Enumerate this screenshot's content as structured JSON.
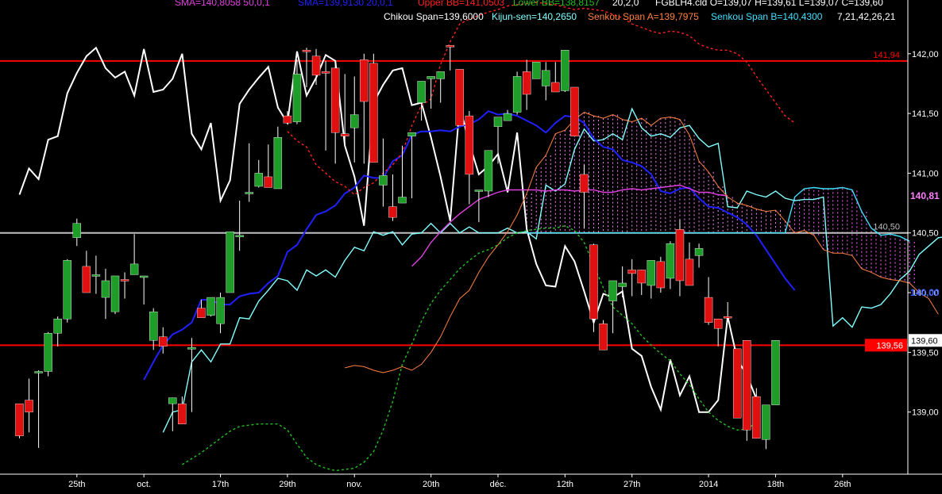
{
  "chart_data": {
    "type": "candlestick",
    "symbol_line": "FGBLH4.cld O=139,07 H=139,61 L=139,07 C=139,60",
    "indicator_labels": [
      {
        "text": "SMA=140,8058  50,0,1",
        "color": "#e040e0"
      },
      {
        "text": "SMA=139,9130  20,0,1",
        "color": "#2020ff"
      },
      {
        "text": "Upper BB=141,0503",
        "color": "#ff2020"
      },
      {
        "text": "Lower BB=138,8157",
        "color": "#20c020"
      },
      {
        "text": "20,2,0",
        "color": "#ffffff"
      },
      {
        "text": "Chikou Span=139,6000",
        "color": "#ffffff"
      },
      {
        "text": "Kijun-sen=140,2650",
        "color": "#80ffff"
      },
      {
        "text": "Senkou Span A=139,7975",
        "color": "#ff8040"
      },
      {
        "text": "Senkou Span B=140,4300",
        "color": "#40e0ff"
      },
      {
        "text": "7,21,42,26,21",
        "color": "#ffffff"
      }
    ],
    "y_axis": {
      "min": 138.48,
      "max": 142.45,
      "ticks": [
        "139,00",
        "139,50",
        "140,00",
        "140,50",
        "141,00",
        "141,50",
        "142,00"
      ],
      "tick_values": [
        139.0,
        139.5,
        140.0,
        140.5,
        141.0,
        141.5,
        142.0
      ]
    },
    "x_axis": {
      "labels": [
        "25th",
        "oct.",
        "17th",
        "29th",
        "nov.",
        "20th",
        "déc.",
        "12th",
        "27th",
        "2014",
        "18th",
        "26th"
      ],
      "label_bars": [
        6,
        13,
        21,
        28,
        35,
        43,
        50,
        57,
        64,
        72,
        79,
        86
      ],
      "total_bars": 94
    },
    "horizontal_lines": [
      {
        "value": 141.94,
        "label": "141,94",
        "color": "#ff0000"
      },
      {
        "value": 140.5,
        "label": "140,50",
        "color": "#c0c0c0"
      },
      {
        "value": 139.56,
        "label": "139,56",
        "color": "#ff0000"
      }
    ],
    "price_badges": [
      {
        "value": 140.81,
        "label": "140,81",
        "color": "#ff80ff"
      },
      {
        "value": 140.0,
        "label": "140,00",
        "color": "#4060ff"
      },
      {
        "value": 139.6,
        "label": "139,60",
        "color": "#ffffff"
      }
    ],
    "candles": [
      [
        139.07,
        139.07,
        138.78,
        138.8
      ],
      [
        139.1,
        139.28,
        138.83,
        139.0
      ],
      [
        139.34,
        139.35,
        138.7,
        139.34
      ],
      [
        139.34,
        139.67,
        139.3,
        139.66
      ],
      [
        139.66,
        139.8,
        139.55,
        139.78
      ],
      [
        139.78,
        140.28,
        139.75,
        140.27
      ],
      [
        140.46,
        140.62,
        140.39,
        140.58
      ],
      [
        140.22,
        140.35,
        140.0,
        140.0
      ],
      [
        140.14,
        140.31,
        139.99,
        140.15
      ],
      [
        139.96,
        140.2,
        139.78,
        140.1
      ],
      [
        139.84,
        140.05,
        139.82,
        140.14
      ],
      [
        140.11,
        140.17,
        139.95,
        140.1
      ],
      [
        140.15,
        140.49,
        140.15,
        140.24
      ],
      [
        140.14,
        140.1,
        139.9,
        140.14
      ],
      [
        139.6,
        139.87,
        139.52,
        139.84
      ],
      [
        139.63,
        139.71,
        139.49,
        139.55
      ],
      [
        139.07,
        139.05,
        138.84,
        139.12
      ],
      [
        139.07,
        139.13,
        138.91,
        138.9
      ],
      [
        139.53,
        139.62,
        139.0,
        139.54
      ],
      [
        139.87,
        139.94,
        139.8,
        139.79
      ],
      [
        139.81,
        139.95,
        139.8,
        139.96
      ],
      [
        139.74,
        140.0,
        139.66,
        139.96
      ],
      [
        140.0,
        140.48,
        140.0,
        140.51
      ],
      [
        140.47,
        140.77,
        140.35,
        140.48
      ],
      [
        140.83,
        141.25,
        140.76,
        140.84
      ],
      [
        140.89,
        141.11,
        140.88,
        141.0
      ],
      [
        140.97,
        141.24,
        140.96,
        140.88
      ],
      [
        140.87,
        141.39,
        141.0,
        141.3
      ],
      [
        141.48,
        141.45,
        141.52,
        141.42
      ],
      [
        141.43,
        141.95,
        141.41,
        141.83
      ],
      [
        142.03,
        142.05,
        141.72,
        142.02
      ],
      [
        141.98,
        142.04,
        141.74,
        141.82
      ],
      [
        141.85,
        141.94,
        141.19,
        141.84
      ],
      [
        141.88,
        141.93,
        141.08,
        141.34
      ],
      [
        141.33,
        141.83,
        141.23,
        141.31
      ],
      [
        141.38,
        141.81,
        141.09,
        141.49
      ],
      [
        141.95,
        142.0,
        141.08,
        141.6
      ],
      [
        141.92,
        142.0,
        141.73,
        141.09
      ],
      [
        140.9,
        141.29,
        140.72,
        140.98
      ],
      [
        140.72,
        140.99,
        140.6,
        140.63
      ],
      [
        140.75,
        141.23,
        140.75,
        140.8
      ],
      [
        141.31,
        141.31,
        140.79,
        141.34
      ],
      [
        141.59,
        141.54,
        141.44,
        141.77
      ],
      [
        141.79,
        141.78,
        141.54,
        141.81
      ],
      [
        141.79,
        141.59,
        141.7,
        141.85
      ],
      [
        142.07,
        142.05,
        141.86,
        142.06
      ],
      [
        141.87,
        141.86,
        141.82,
        141.4
      ],
      [
        141.48,
        141.52,
        140.74,
        140.99
      ],
      [
        140.85,
        140.79,
        140.59,
        140.86
      ],
      [
        140.85,
        140.96,
        140.8,
        141.19
      ],
      [
        141.39,
        141.35,
        141.08,
        141.47
      ],
      [
        141.44,
        141.53,
        141.46,
        141.5
      ],
      [
        141.51,
        141.85,
        141.49,
        141.81
      ],
      [
        141.85,
        141.95,
        141.53,
        141.66
      ],
      [
        141.79,
        141.84,
        141.84,
        141.93
      ],
      [
        141.73,
        141.93,
        141.61,
        141.86
      ],
      [
        141.76,
        141.93,
        141.8,
        141.68
      ],
      [
        141.69,
        142.0,
        141.68,
        142.03
      ],
      [
        141.72,
        141.63,
        141.36,
        141.31
      ],
      [
        140.99,
        141.07,
        140.54,
        140.84
      ],
      [
        140.4,
        140.41,
        139.67,
        139.78
      ],
      [
        139.74,
        139.76,
        139.77,
        139.52
      ],
      [
        139.93,
        139.93,
        139.66,
        140.1
      ],
      [
        140.05,
        140.22,
        139.96,
        140.08
      ],
      [
        140.19,
        140.28,
        139.97,
        140.16
      ],
      [
        140.19,
        140.15,
        139.98,
        140.08
      ],
      [
        140.06,
        140.1,
        139.95,
        140.27
      ],
      [
        140.26,
        140.3,
        140.0,
        140.04
      ],
      [
        140.12,
        140.43,
        140.03,
        140.41
      ],
      [
        140.53,
        140.61,
        139.97,
        140.1
      ],
      [
        140.28,
        140.42,
        140.35,
        140.06
      ],
      [
        140.31,
        140.41,
        140.21,
        140.37
      ],
      [
        139.96,
        140.13,
        139.73,
        139.75
      ],
      [
        139.78,
        139.78,
        139.55,
        139.7
      ],
      [
        139.8,
        139.92,
        139.79,
        139.79
      ],
      [
        139.53,
        139.5,
        139.0,
        138.95
      ],
      [
        139.6,
        139.58,
        138.76,
        138.85
      ],
      [
        139.13,
        139.2,
        138.8,
        138.78
      ],
      [
        138.77,
        139.0,
        138.69,
        139.06
      ],
      [
        139.06,
        139.07,
        139.07,
        139.6
      ]
    ],
    "series": [
      {
        "name": "Chikou Span",
        "color": "#ffffff",
        "values": [
          140.82,
          141.04,
          140.95,
          141.28,
          141.31,
          141.67,
          141.84,
          141.98,
          142.05,
          141.88,
          141.8,
          141.85,
          141.65,
          142.04,
          141.68,
          141.7,
          141.79,
          142.0,
          141.33,
          141.2,
          141.42,
          140.77,
          140.94,
          141.58,
          141.7,
          141.8,
          141.89,
          141.55,
          141.42,
          142.02,
          141.65,
          141.8,
          141.99,
          141.94,
          141.23,
          140.97,
          140.56,
          141.59,
          141.74,
          141.86,
          141.88,
          141.57,
          141.59,
          141.3,
          140.97,
          140.6,
          141.56,
          141.25,
          140.99,
          141.06,
          141.16,
          140.84,
          141.34,
          140.53,
          140.24,
          140.06,
          140.05,
          140.39,
          140.26,
          140.01,
          139.75,
          139.99,
          139.96,
          140.01,
          139.53,
          139.47,
          139.21,
          139.02,
          139.44,
          139.14,
          139.3,
          139.0,
          139.0,
          139.1,
          139.8,
          139.44,
          139.31,
          139.11
        ]
      },
      {
        "name": "Kijun-sen",
        "color": "#80ffff",
        "values": [
          138.83,
          139.0,
          139.02,
          139.42,
          139.52,
          139.42,
          139.57,
          139.57,
          139.79,
          139.78,
          139.93,
          140.02,
          140.12,
          140.1,
          140.02,
          140.19,
          140.14,
          140.19,
          140.13,
          140.27,
          140.38,
          140.35,
          140.51,
          140.48,
          140.51,
          140.4,
          140.49,
          140.5,
          140.58,
          140.5,
          140.58,
          140.5,
          140.55,
          140.5,
          140.5,
          140.5,
          140.54,
          140.5,
          140.51,
          140.45,
          140.9,
          140.85,
          140.91,
          141.2,
          141.37,
          141.27,
          141.28,
          141.33,
          141.28,
          141.54,
          141.38,
          141.31,
          141.33,
          141.3,
          141.38,
          141.4,
          141.29,
          141.22,
          141.25,
          140.72,
          140.71,
          140.85,
          140.82,
          140.8,
          140.85,
          140.79,
          140.77,
          140.78,
          140.78,
          140.8,
          139.72,
          139.79,
          139.71,
          139.88,
          139.87,
          139.9,
          139.99,
          140.11,
          140.18,
          140.32,
          140.39,
          140.46,
          140.47,
          140.5
        ]
      },
      {
        "name": "SMA 20",
        "color": "#2020ff",
        "values": [
          139.27,
          139.42,
          139.56,
          139.65,
          139.69,
          139.75,
          139.94,
          139.94,
          139.9,
          139.9,
          139.97,
          139.99,
          140.0,
          140.08,
          140.14,
          140.34,
          140.4,
          140.53,
          140.65,
          140.68,
          140.73,
          140.83,
          140.88,
          140.98,
          140.96,
          140.96,
          141.1,
          141.15,
          141.32,
          141.35,
          141.35,
          141.36,
          141.35,
          141.39,
          141.41,
          141.45,
          141.52,
          141.49,
          141.5,
          141.48,
          141.44,
          141.4,
          141.34,
          141.42,
          141.48,
          141.47,
          141.42,
          141.29,
          141.22,
          141.2,
          141.11,
          141.09,
          141.06,
          140.99,
          140.85,
          140.83,
          140.87,
          140.88,
          140.79,
          140.72,
          140.71,
          140.67,
          140.63,
          140.57,
          140.48,
          140.36,
          140.24,
          140.12,
          140.02
        ]
      },
      {
        "name": "SMA 50",
        "color": "#e040e0",
        "values": [
          140.22,
          140.3,
          140.42,
          140.51,
          140.59,
          140.66,
          140.72,
          140.78,
          140.81,
          140.84,
          140.86,
          140.86,
          140.86,
          140.86,
          140.85,
          140.86,
          140.86,
          140.85,
          140.86,
          140.86,
          140.84,
          140.84,
          140.86,
          140.87,
          140.86,
          140.87,
          140.88,
          140.89,
          140.9,
          140.87,
          140.84,
          140.84,
          140.82,
          140.81
        ]
      },
      {
        "name": "Senkou Span A",
        "color": "#ff8040",
        "values": [
          139.37,
          139.39,
          139.38,
          139.35,
          139.33,
          139.35,
          139.38,
          139.35,
          139.4,
          139.5,
          139.63,
          139.8,
          139.95,
          140.02,
          140.17,
          140.3,
          140.4,
          140.51,
          140.65,
          140.83,
          141.05,
          141.15,
          141.33,
          141.36,
          141.45,
          141.51,
          141.48,
          141.46,
          141.49,
          141.45,
          141.43,
          141.46,
          141.4,
          141.46,
          141.47,
          141.45,
          141.32,
          141.1,
          141.01,
          140.89,
          140.8,
          140.75,
          140.73,
          140.7,
          140.68,
          140.69,
          140.6,
          140.5,
          140.52,
          140.48,
          140.36,
          140.33,
          140.33,
          140.31,
          140.2,
          140.17,
          140.13,
          140.11,
          140.1,
          140.08,
          140.0,
          139.95,
          139.82
        ]
      },
      {
        "name": "Senkou Span B",
        "color": "#40e0ff",
        "values": [
          140.5,
          140.5,
          140.5,
          140.5,
          140.5,
          140.5,
          140.5,
          140.5,
          140.5,
          140.5,
          140.5,
          140.5,
          140.5,
          140.5,
          140.5,
          140.5,
          140.5,
          140.5,
          140.5,
          140.5,
          140.5,
          140.5,
          140.5,
          140.5,
          140.5,
          140.5,
          140.5,
          140.5,
          140.8,
          140.87,
          140.88,
          140.87,
          140.87,
          140.88,
          140.86,
          140.68,
          140.54,
          140.48,
          140.49,
          140.47,
          140.43
        ]
      },
      {
        "name": "Upper BB",
        "color": "#ff2020",
        "values": [
          141.35,
          141.27,
          141.22,
          141.07,
          141.0,
          140.93,
          140.89,
          140.82,
          140.88,
          140.92,
          141.0,
          141.07,
          141.17,
          141.4,
          141.57,
          141.62,
          141.91,
          142.1,
          142.25,
          142.29,
          142.32,
          142.35,
          142.37,
          142.4,
          142.41,
          142.42,
          142.43,
          142.42,
          142.41,
          142.39,
          142.37,
          142.38,
          142.37,
          142.36,
          142.33,
          142.3,
          142.25,
          142.22,
          142.19,
          142.17,
          142.19,
          142.18,
          142.15,
          142.08,
          142.05,
          142.03,
          142.03,
          142.0,
          141.93,
          141.81,
          141.7,
          141.59,
          141.48,
          141.42
        ]
      },
      {
        "name": "Lower BB",
        "color": "#20c020",
        "values": [
          138.56,
          138.61,
          138.66,
          138.72,
          138.78,
          138.84,
          138.88,
          138.89,
          138.9,
          138.9,
          138.9,
          138.85,
          138.73,
          138.62,
          138.56,
          138.53,
          138.51,
          138.52,
          138.53,
          138.58,
          138.67,
          138.85,
          139.09,
          139.4,
          139.57,
          139.76,
          139.91,
          140.02,
          140.11,
          140.2,
          140.27,
          140.33,
          140.36,
          140.4,
          140.46,
          140.5,
          140.52,
          140.53,
          140.54,
          140.54,
          140.56,
          140.52,
          140.42,
          140.23,
          140.04,
          139.88,
          139.81,
          139.74,
          139.64,
          139.56,
          139.49,
          139.43,
          139.32,
          139.23,
          139.11,
          139.0,
          138.93,
          138.88,
          138.85,
          138.86,
          138.91
        ]
      }
    ]
  }
}
